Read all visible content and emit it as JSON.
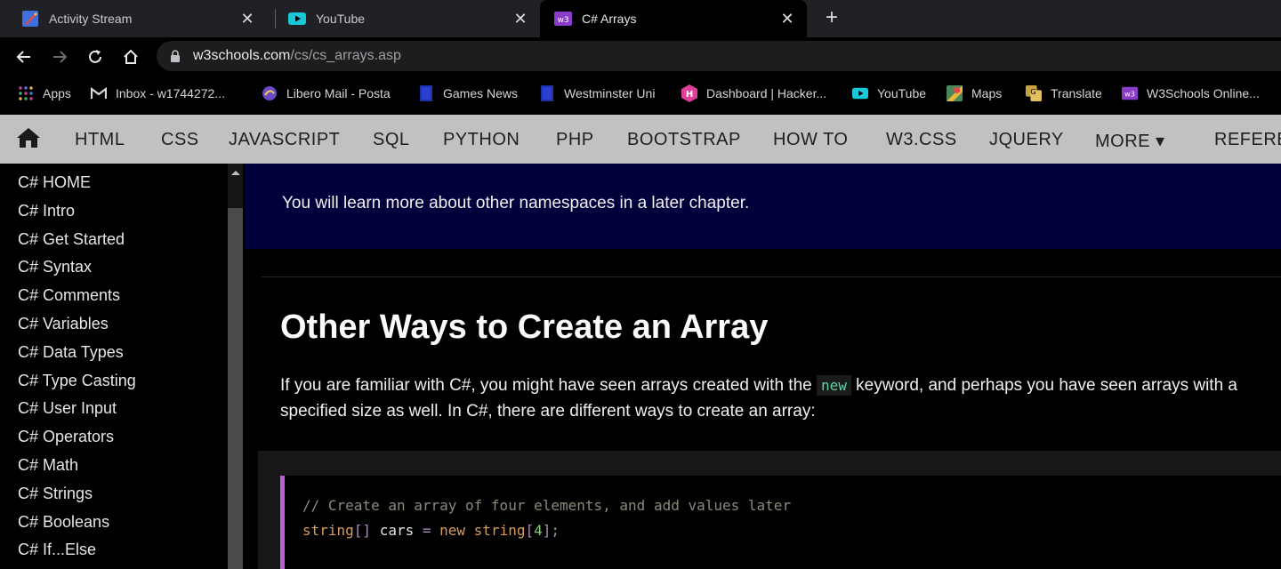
{
  "tabs": [
    {
      "title": "Activity Stream",
      "icon": "activity-stream-icon",
      "active": false
    },
    {
      "title": "YouTube",
      "icon": "youtube-icon",
      "active": false
    },
    {
      "title": "C# Arrays",
      "icon": "w3schools-icon",
      "active": true
    }
  ],
  "new_tab_symbol": "+",
  "close_symbol": "✕",
  "address": {
    "host": "w3schools.com",
    "path": "/cs/cs_arrays.asp"
  },
  "bookmarks": [
    {
      "label": "Apps",
      "icon": "apps-grid-icon"
    },
    {
      "label": "Inbox - w1744272...",
      "icon": "gmail-icon"
    },
    {
      "label": "Libero Mail - Posta",
      "icon": "libero-icon"
    },
    {
      "label": "Games News",
      "icon": "bookmark-page-icon"
    },
    {
      "label": "Westminster Uni",
      "icon": "bookmark-page-icon"
    },
    {
      "label": "Dashboard | Hacker...",
      "icon": "hackerrank-icon"
    },
    {
      "label": "YouTube",
      "icon": "youtube-icon"
    },
    {
      "label": "Maps",
      "icon": "maps-icon"
    },
    {
      "label": "Translate",
      "icon": "translate-icon"
    },
    {
      "label": "W3Schools Online...",
      "icon": "w3schools-icon"
    }
  ],
  "topnav": [
    "HTML",
    "CSS",
    "JAVASCRIPT",
    "SQL",
    "PYTHON",
    "PHP",
    "BOOTSTRAP",
    "HOW TO",
    "W3.CSS",
    "JQUERY",
    "MORE ▾",
    "REFERE"
  ],
  "sidebar": [
    "C# HOME",
    "C# Intro",
    "C# Get Started",
    "C# Syntax",
    "C# Comments",
    "C# Variables",
    "C# Data Types",
    "C# Type Casting",
    "C# User Input",
    "C# Operators",
    "C# Math",
    "C# Strings",
    "C# Booleans",
    "C# If...Else"
  ],
  "main": {
    "note": "You will learn more about other namespaces in a later chapter.",
    "heading": "Other Ways to Create an Array",
    "para1_before": "If you are familiar with C#, you might have seen arrays created with the ",
    "para1_keyword": "new",
    "para1_after": " keyword, and perhaps you have seen arrays with a",
    "para2": "specified size as well. In C#, there are different ways to create an array:",
    "code_comment": "// Create an array of four elements, and add values later",
    "code_line": {
      "type": "string",
      "brackets": "[]",
      "name": " cars ",
      "eq": "=",
      "kw_new": " new ",
      "type2": "string",
      "open": "[",
      "num": "4",
      "close": "];"
    }
  },
  "colors": {
    "tabstrip": "#202124",
    "topnav": "#c1c1c1",
    "note_bg": "#00003b",
    "code_border": "#c05cd6",
    "keyword": "#5fd3a4"
  }
}
